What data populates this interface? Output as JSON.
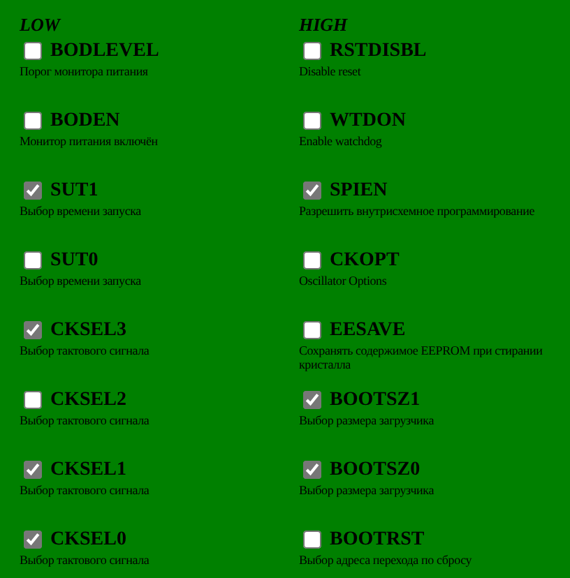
{
  "columns": [
    {
      "title": "LOW",
      "fuses": [
        {
          "name": "BODLEVEL",
          "description": "Порог монитора питания",
          "checked": false
        },
        {
          "name": "BODEN",
          "description": "Монитор питания включён",
          "checked": false
        },
        {
          "name": "SUT1",
          "description": "Выбор времени запуска",
          "checked": true
        },
        {
          "name": "SUT0",
          "description": "Выбор времени запуска",
          "checked": false
        },
        {
          "name": "CKSEL3",
          "description": "Выбор тактового сигнала",
          "checked": true
        },
        {
          "name": "CKSEL2",
          "description": "Выбор тактового сигнала",
          "checked": false
        },
        {
          "name": "CKSEL1",
          "description": "Выбор тактового сигнала",
          "checked": true
        },
        {
          "name": "CKSEL0",
          "description": "Выбор тактового сигнала",
          "checked": true
        }
      ]
    },
    {
      "title": "HIGH",
      "fuses": [
        {
          "name": "RSTDISBL",
          "description": "Disable reset",
          "checked": false
        },
        {
          "name": "WTDON",
          "description": "Enable watchdog",
          "checked": false
        },
        {
          "name": "SPIEN",
          "description": "Разрешить внутрисхемное программирование",
          "checked": true
        },
        {
          "name": "CKOPT",
          "description": "Oscillator Options",
          "checked": false
        },
        {
          "name": "EESAVE",
          "description": "Сохранять содержимое EEPROM при стирании кристалла",
          "checked": false
        },
        {
          "name": "BOOTSZ1",
          "description": "Выбор размера загрузчика",
          "checked": true
        },
        {
          "name": "BOOTSZ0",
          "description": "Выбор размера загрузчика",
          "checked": true
        },
        {
          "name": "BOOTRST",
          "description": "Выбор адреса перехода по сбросу",
          "checked": false
        }
      ]
    }
  ]
}
